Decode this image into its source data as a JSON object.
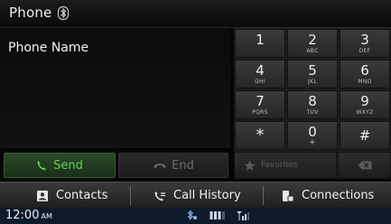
{
  "header": {
    "title": "Phone",
    "bluetooth_icon": "bluetooth-icon"
  },
  "left_panel": {
    "phone_name": "Phone Name"
  },
  "call_buttons": {
    "send_label": "Send",
    "end_label": "End",
    "send_color": "#5fd64a"
  },
  "keypad": {
    "keys": [
      {
        "digit": "1",
        "letters": ""
      },
      {
        "digit": "2",
        "letters": "ABC"
      },
      {
        "digit": "3",
        "letters": "DEF"
      },
      {
        "digit": "4",
        "letters": "GHI"
      },
      {
        "digit": "5",
        "letters": "JKL"
      },
      {
        "digit": "6",
        "letters": "MNO"
      },
      {
        "digit": "7",
        "letters": "PQRS"
      },
      {
        "digit": "8",
        "letters": "TUV"
      },
      {
        "digit": "9",
        "letters": "WXYZ"
      },
      {
        "digit": "*",
        "letters": ""
      },
      {
        "digit": "0",
        "letters": "+"
      },
      {
        "digit": "#",
        "letters": ""
      }
    ],
    "favorites_label": "Favorites"
  },
  "tabs": {
    "contacts": "Contacts",
    "call_history": "Call History",
    "connections": "Connections"
  },
  "status_bar": {
    "time": "12:00",
    "ampm": "AM"
  }
}
